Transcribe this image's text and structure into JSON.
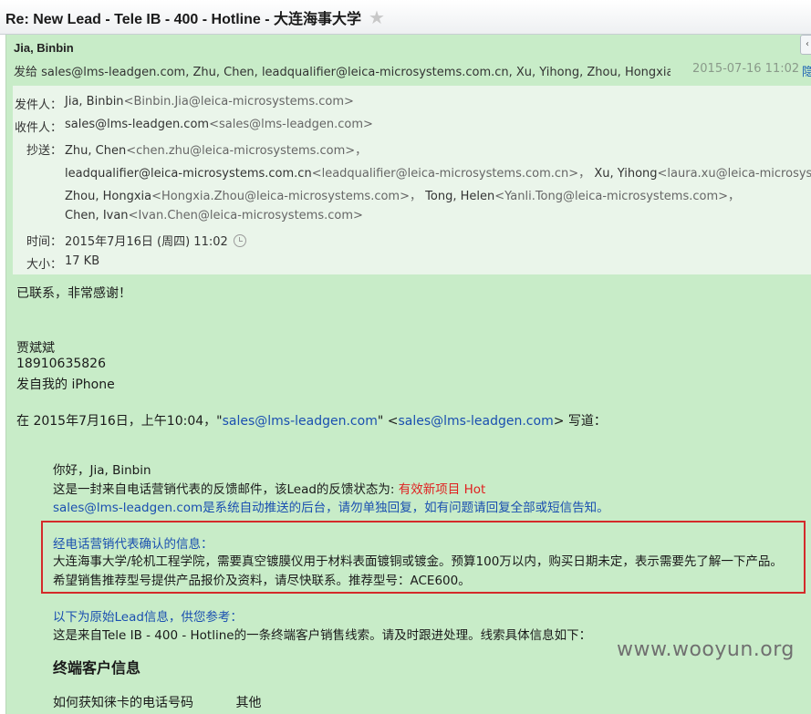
{
  "subject": "Re: New Lead - Tele IB - 400 - Hotline - 大连海事大学",
  "header": {
    "from_name": "Jia, Binbin",
    "sendto": "发给 sales@lms-leadgen.com, Zhu, Chen, leadqualifier@leica-microsystems.com.cn, Xu, Yihong, Zhou, Hongxia, To...",
    "date": "2015-07-16 11:02",
    "hide_link": "隐"
  },
  "details": {
    "from_label": "发件人：",
    "from_value": "Jia, Binbin",
    "from_email": "<Binbin.Jia@leica-microsystems.com>",
    "to_label": "收件人：",
    "to_value": "sales@lms-leadgen.com",
    "to_email": "<sales@lms-leadgen.com>",
    "cc_label": "抄送：",
    "cc_line1_name": "Zhu, Chen",
    "cc_line1_email": "<chen.zhu@leica-microsystems.com>，",
    "cc_line2_name": "leadqualifier@leica-microsystems.com.cn",
    "cc_line2_email": "<leadqualifier@leica-microsystems.com.cn>，",
    "cc_line2_name2": "Xu, Yihong",
    "cc_line2_email2": "<laura.xu@leica-microsystems.com>",
    "cc_line3_name": "Zhou, Hongxia",
    "cc_line3_email": "<Hongxia.Zhou@leica-microsystems.com>，",
    "cc_line3_name2": "Tong, Helen",
    "cc_line3_email2": "<Yanli.Tong@leica-microsystems.com>，",
    "cc_line4_name": "Chen, Ivan",
    "cc_line4_email": "<Ivan.Chen@leica-microsystems.com>",
    "time_label": "时间：",
    "time_value": "2015年7月16日 (周四) 11:02",
    "size_label": "大小：",
    "size_value": "17 KB"
  },
  "body": {
    "line1": "已联系，非常感谢！",
    "sig_name": "贾斌斌",
    "sig_phone": "18910635826",
    "sig_device": "发自我的 iPhone",
    "quote_prefix": "在 2015年7月16日，上午10:04，\"",
    "quote_email1": "sales@lms-leadgen.com",
    "quote_mid": "\" <",
    "quote_email2": "sales@lms-leadgen.com",
    "quote_suffix": "> 写道：",
    "greeting": "你好，Jia, Binbin",
    "feedback_text": "这是一封来自电话营销代表的反馈邮件，该Lead的反馈状态为: ",
    "feedback_status": "有效新项目 Hot",
    "notice": "sales@lms-leadgen.com是系统自动推送的后台，请勿单独回复，如有问题请回复全部或短信告知。",
    "confirm_title": "经电话营销代表确认的信息：",
    "confirm_line1": "大连海事大学/轮机工程学院，需要真空镀膜仪用于材料表面镀铜或镀金。预算100万以内，购买日期未定，表示需要先了解一下产品。",
    "confirm_line2": "希望销售推荐型号提供产品报价及资料，请尽快联系。推荐型号：ACE600。",
    "orig_title": "以下为原始Lead信息，供您参考：",
    "orig_line": "这是来自Tele IB - 400 - Hotline的一条终端客户销售线索。请及时跟进处理。线索具体信息如下：",
    "section_title": "终端客户信息",
    "field_label": "如何获知徕卡的电话号码",
    "field_value": "其他"
  },
  "watermark": "www.wooyun.org"
}
